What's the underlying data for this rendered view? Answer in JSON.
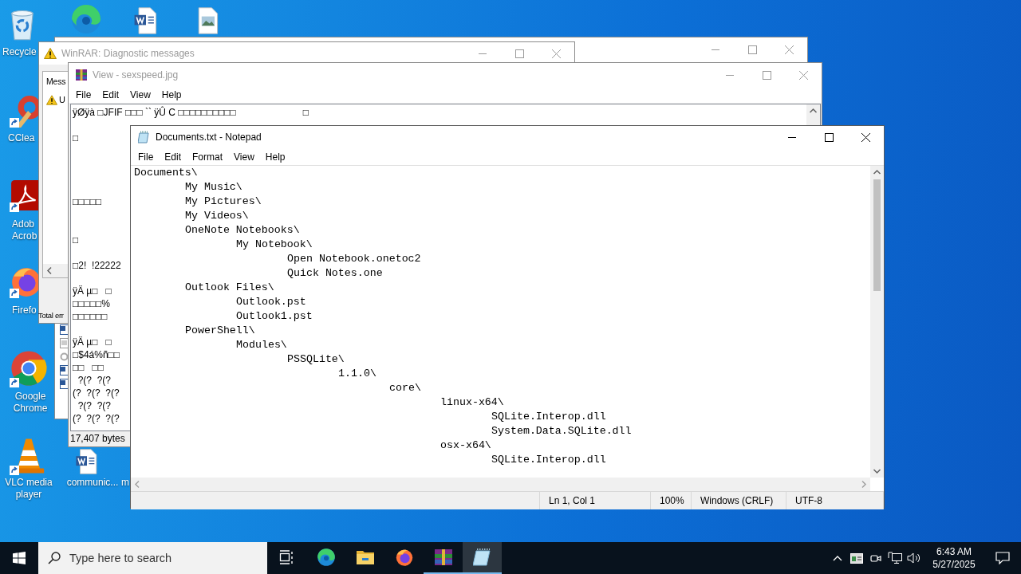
{
  "desktop_icons": [
    {
      "kind": "recycle-bin",
      "label_lines": [
        "Recycle"
      ],
      "shortcut": false
    },
    {
      "kind": "edge",
      "shortcut": false
    },
    {
      "kind": "word-doc",
      "shortcut": false
    },
    {
      "kind": "image-doc",
      "shortcut": false
    },
    {
      "kind": "ccleaner",
      "label_lines": [
        "CClea"
      ],
      "shortcut": true
    },
    {
      "kind": "acrobat",
      "label_lines": [
        "Adob",
        "Acrob"
      ],
      "shortcut": true
    },
    {
      "kind": "firefox",
      "label_lines": [
        "Firefo"
      ],
      "shortcut": true
    },
    {
      "kind": "chrome",
      "label_lines": [
        "Google",
        "Chrome"
      ],
      "shortcut": true
    },
    {
      "kind": "vlc",
      "label_lines": [
        "VLC media",
        "player"
      ],
      "shortcut": true
    },
    {
      "kind": "word-doc",
      "label_lines": [
        "communic..."
      ],
      "shortcut": false
    },
    {
      "label_lines": [
        "m"
      ]
    }
  ],
  "diagnostic_window": {
    "title": "WinRAR: Diagnostic messages",
    "active": false,
    "column_header": "Mess",
    "message_rows": [
      {
        "text": "U"
      }
    ],
    "footer": "Total err"
  },
  "viewer_window": {
    "title": "View - sexspeed.jpg",
    "active": false,
    "menu": [
      "File",
      "Edit",
      "View",
      "Help"
    ],
    "lines": [
      {
        "segments": [
          "ÿØÿà □JFIF □□□ `` ÿÛ C □□□□□□□□□□",
          "□"
        ]
      },
      {
        "segments": [
          "□"
        ]
      },
      {
        "segments": [
          "□□□□□"
        ]
      },
      {
        "segments": [
          "□"
        ]
      },
      {
        "segments": [
          "□2!  !22222"
        ]
      },
      {
        "segments": [
          "ÿÄ µ□   □"
        ]
      },
      {
        "segments": [
          "□□□□□%"
        ]
      },
      {
        "segments": [
          "□□□□□□"
        ]
      },
      {
        "segments": [
          "ÿÄ µ□   □"
        ]
      },
      {
        "segments": [
          "□$4á%ñ□□"
        ]
      },
      {
        "segments": [
          "□□   □□"
        ]
      },
      {
        "segments": [
          "  ?(?  ?(?"
        ]
      },
      {
        "segments": [
          "(?  ?(?  ?(?"
        ]
      },
      {
        "segments": [
          "  ?(?  ?(?"
        ]
      },
      {
        "segments": [
          "(?  ?(?  ?(?"
        ]
      }
    ],
    "status": "17,407 bytes"
  },
  "notepad": {
    "title": "Documents.txt - Notepad",
    "active": true,
    "menu": [
      "File",
      "Edit",
      "Format",
      "View",
      "Help"
    ],
    "content": [
      {
        "text": "Documents\\",
        "children": [
          {
            "text": "My Music\\"
          },
          {
            "text": "My Pictures\\"
          },
          {
            "text": "My Videos\\"
          },
          {
            "text": "OneNote Notebooks\\",
            "children": [
              {
                "text": "My Notebook\\",
                "children": [
                  {
                    "text": "Open Notebook.onetoc2"
                  },
                  {
                    "text": "Quick Notes.one"
                  }
                ]
              }
            ]
          },
          {
            "text": "Outlook Files\\",
            "children": [
              {
                "text": "Outlook.pst"
              },
              {
                "text": "Outlook1.pst"
              }
            ]
          },
          {
            "text": "PowerShell\\",
            "children": [
              {
                "text": "Modules\\",
                "children": [
                  {
                    "text": "PSSQLite\\",
                    "children": [
                      {
                        "text": "1.1.0\\",
                        "children": [
                          {
                            "text": "core\\",
                            "children": [
                              {
                                "text": "linux-x64\\",
                                "children": [
                                  {
                                    "text": "SQLite.Interop.dll"
                                  },
                                  {
                                    "text": "System.Data.SQLite.dll"
                                  }
                                ]
                              },
                              {
                                "text": "osx-x64\\",
                                "children": [
                                  {
                                    "text": "SQLite.Interop.dll"
                                  }
                                ]
                              }
                            ]
                          }
                        ]
                      }
                    ]
                  }
                ]
              }
            ]
          }
        ]
      }
    ],
    "status_bar": [
      "Ln 1, Col 1",
      "100%",
      "Windows (CRLF)",
      "UTF-8"
    ]
  },
  "taskbar": {
    "search_placeholder": "Type here to search",
    "apps": [
      {
        "kind": "task-view",
        "running": false,
        "selected": false
      },
      {
        "kind": "edge",
        "running": false,
        "selected": false
      },
      {
        "kind": "explorer",
        "running": false,
        "selected": false
      },
      {
        "kind": "firefox",
        "running": false,
        "selected": false
      },
      {
        "kind": "winrar",
        "running": true,
        "selected": false
      },
      {
        "kind": "notepad",
        "running": true,
        "selected": true
      }
    ],
    "tray": [
      {
        "kind": "chevron"
      },
      {
        "kind": "input-indicator"
      },
      {
        "kind": "meet"
      },
      {
        "kind": "network"
      },
      {
        "kind": "volume"
      }
    ],
    "time": "6:43 AM",
    "date": "5/27/2025"
  }
}
